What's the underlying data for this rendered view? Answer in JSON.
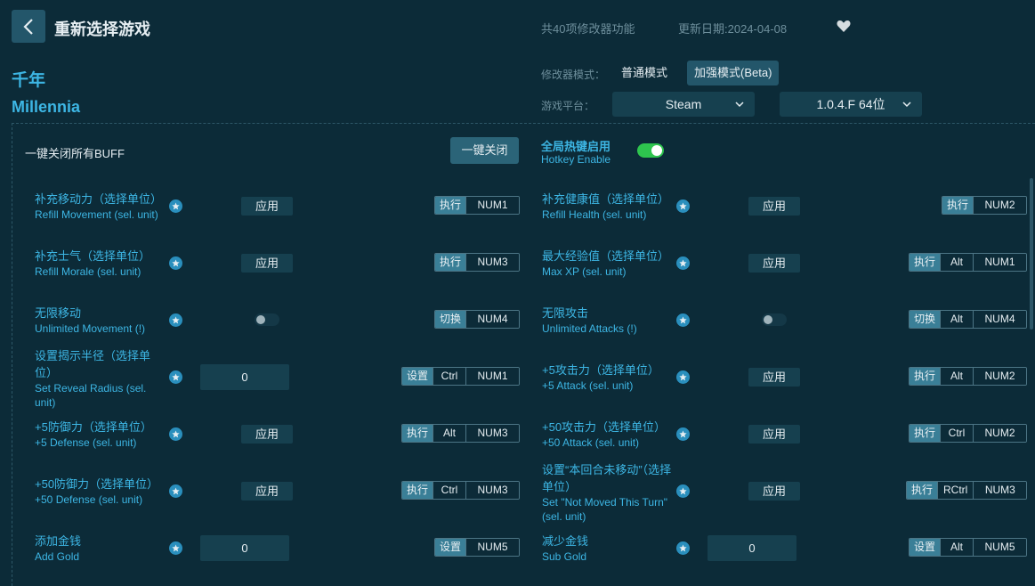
{
  "header": {
    "title": "重新选择游戏",
    "feature_count": "共40项修改器功能",
    "update_date": "更新日期:2024-04-08"
  },
  "game": {
    "name_cn": "千年",
    "name_en": "Millennia"
  },
  "mode": {
    "label": "修改器模式：",
    "normal": "普通模式",
    "enhanced": "加强模式(Beta)",
    "selected": "加强模式(Beta)"
  },
  "platform": {
    "label": "游戏平台：",
    "value": "Steam",
    "version": "1.0.4.F 64位"
  },
  "buff": {
    "label": "一键关闭所有BUFF",
    "button": "一键关闭"
  },
  "hotkey": {
    "label_cn": "全局热键启用",
    "label_en": "Hotkey Enable",
    "enabled": true
  },
  "colors": {
    "background": "#0c2b38",
    "accent": "#3db6e4",
    "toggle_on": "#2ec44e",
    "button": "#16404f"
  },
  "left_rows": [
    {
      "cn": "补充移动力（选择单位）",
      "en": "Refill Movement (sel. unit)",
      "control": "应用",
      "action": "执行",
      "keys": [
        "NUM1"
      ]
    },
    {
      "cn": "补充士气（选择单位）",
      "en": "Refill Morale (sel. unit)",
      "control": "应用",
      "action": "执行",
      "keys": [
        "NUM3"
      ]
    },
    {
      "cn": "无限移动",
      "en": "Unlimited Movement (!)",
      "control": "toggle",
      "action": "切换",
      "keys": [
        "NUM4"
      ]
    },
    {
      "cn": "设置揭示半径（选择单位）",
      "en": "Set Reveal Radius (sel. unit)",
      "control": "0",
      "action": "设置",
      "keys": [
        "Ctrl",
        "NUM1"
      ]
    },
    {
      "cn": "+5防御力（选择单位）",
      "en": "+5 Defense (sel. unit)",
      "control": "应用",
      "action": "执行",
      "keys": [
        "Alt",
        "NUM3"
      ]
    },
    {
      "cn": "+50防御力（选择单位）",
      "en": "+50 Defense (sel. unit)",
      "control": "应用",
      "action": "执行",
      "keys": [
        "Ctrl",
        "NUM3"
      ]
    },
    {
      "cn": "添加金钱",
      "en": "Add Gold",
      "control": "0",
      "action": "设置",
      "keys": [
        "NUM5"
      ]
    }
  ],
  "right_rows": [
    {
      "cn": "补充健康值（选择单位）",
      "en": "Refill Health (sel. unit)",
      "control": "应用",
      "action": "执行",
      "keys": [
        "NUM2"
      ]
    },
    {
      "cn": "最大经验值（选择单位）",
      "en": "Max XP (sel. unit)",
      "control": "应用",
      "action": "执行",
      "keys": [
        "Alt",
        "NUM1"
      ]
    },
    {
      "cn": "无限攻击",
      "en": "Unlimited Attacks (!)",
      "control": "toggle",
      "action": "切换",
      "keys": [
        "Alt",
        "NUM4"
      ]
    },
    {
      "cn": "+5攻击力（选择单位）",
      "en": "+5 Attack (sel. unit)",
      "control": "应用",
      "action": "执行",
      "keys": [
        "Alt",
        "NUM2"
      ]
    },
    {
      "cn": "+50攻击力（选择单位）",
      "en": "+50 Attack (sel. unit)",
      "control": "应用",
      "action": "执行",
      "keys": [
        "Ctrl",
        "NUM2"
      ]
    },
    {
      "cn": "设置“本回合未移动”（选择单位）",
      "en": "Set \"Not Moved This Turn\" (sel. unit)",
      "control": "应用",
      "action": "执行",
      "keys": [
        "RCtrl",
        "NUM3"
      ]
    },
    {
      "cn": "减少金钱",
      "en": "Sub Gold",
      "control": "0",
      "action": "设置",
      "keys": [
        "Alt",
        "NUM5"
      ]
    }
  ]
}
